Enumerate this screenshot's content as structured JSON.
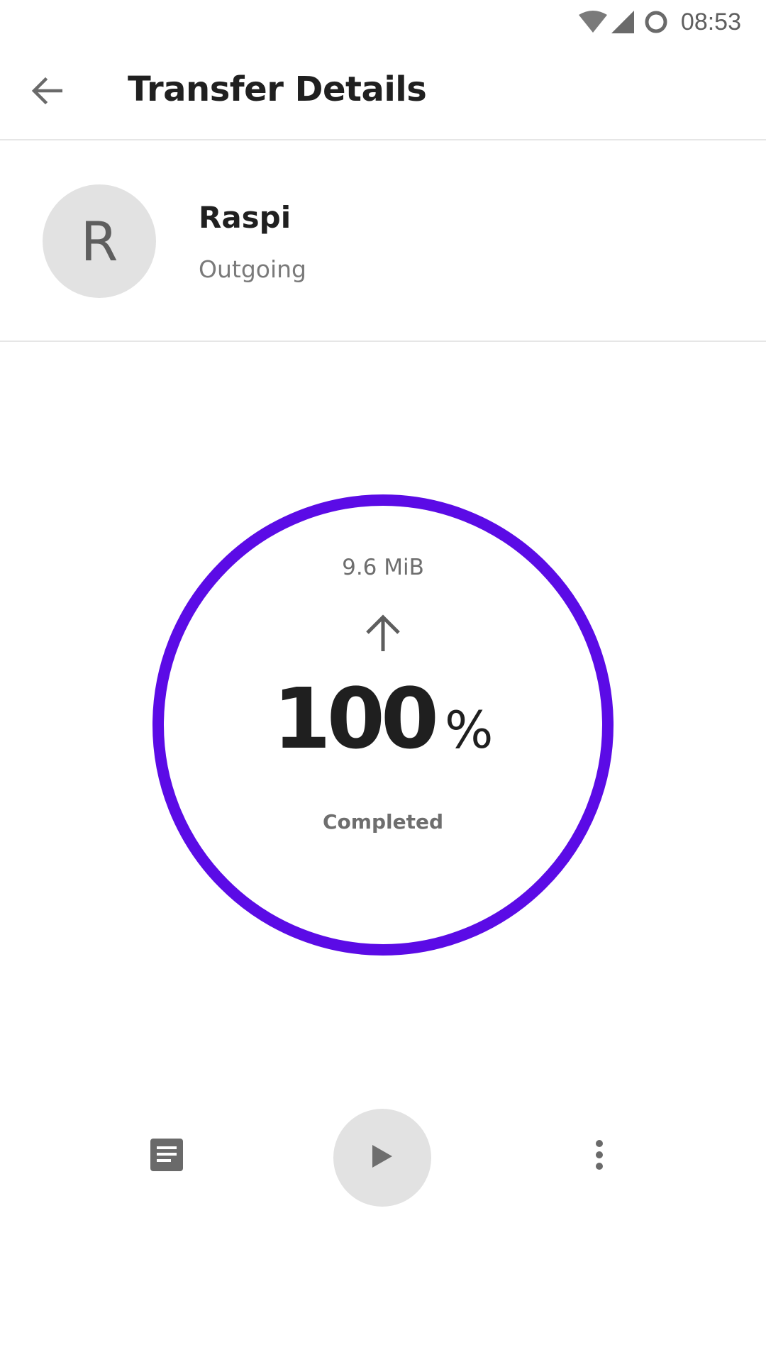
{
  "status_bar": {
    "time": "08:53",
    "icons": [
      "wifi-icon",
      "signal-icon",
      "sync-ring-icon"
    ]
  },
  "toolbar": {
    "title": "Transfer Details",
    "back_icon": "arrow-back-icon"
  },
  "peer": {
    "avatar_letter": "R",
    "name": "Raspi",
    "direction": "Outgoing"
  },
  "transfer": {
    "size": "9.6 MiB",
    "direction_icon": "arrow-up-icon",
    "percent": "100",
    "percent_sign": "%",
    "status": "Completed",
    "progress_fraction": 1.0
  },
  "actions": {
    "files_icon": "document-icon",
    "play_icon": "play-icon",
    "more_icon": "more-vertical-icon"
  },
  "colors": {
    "accent": "#5b0be6",
    "text_primary": "#1f1f1f",
    "text_secondary": "#6e6e6e",
    "avatar_bg": "#e2e2e2"
  }
}
